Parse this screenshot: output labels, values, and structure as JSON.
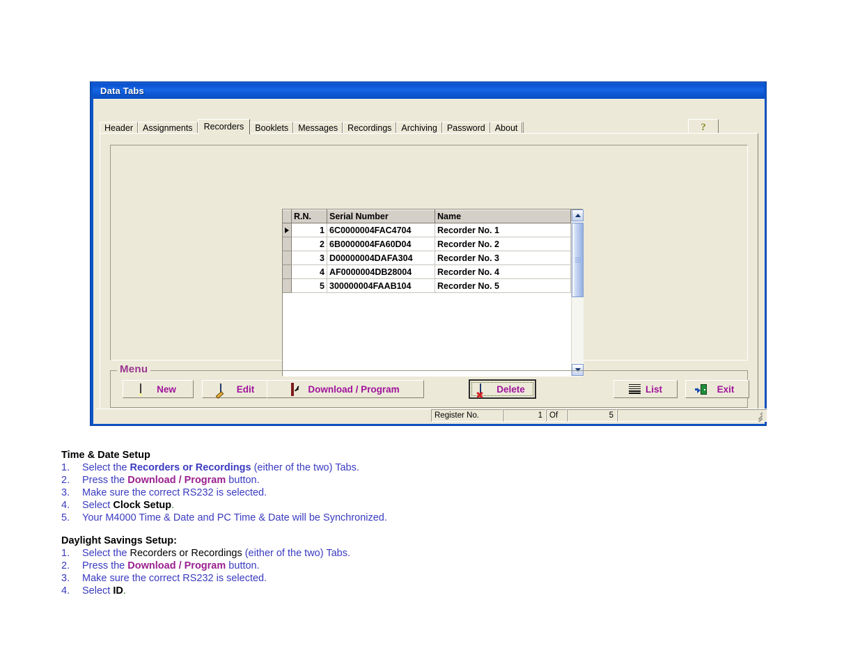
{
  "window": {
    "title": "Data Tabs",
    "help_button": "?",
    "help_icon": "question-mark-icon"
  },
  "tabs": [
    {
      "label": "Header",
      "selected": false
    },
    {
      "label": "Assignments",
      "selected": false
    },
    {
      "label": "Recorders",
      "selected": true
    },
    {
      "label": "Booklets",
      "selected": false
    },
    {
      "label": "Messages",
      "selected": false
    },
    {
      "label": "Recordings",
      "selected": false
    },
    {
      "label": "Archiving",
      "selected": false
    },
    {
      "label": "Password",
      "selected": false
    },
    {
      "label": "About",
      "selected": false
    }
  ],
  "grid": {
    "columns": [
      "R.N.",
      "Serial Number",
      "Name"
    ],
    "rows": [
      {
        "marker": true,
        "rn": "1",
        "serial": "6C0000004FAC4704",
        "name": "Recorder No. 1"
      },
      {
        "marker": false,
        "rn": "2",
        "serial": "6B0000004FA60D04",
        "name": "Recorder No. 2"
      },
      {
        "marker": false,
        "rn": "3",
        "serial": "D00000004DAFA304",
        "name": "Recorder No. 3"
      },
      {
        "marker": false,
        "rn": "4",
        "serial": "AF0000004DB28004",
        "name": "Recorder No. 4"
      },
      {
        "marker": false,
        "rn": "5",
        "serial": "300000004FAAB104",
        "name": "Recorder No. 5"
      }
    ]
  },
  "menu": {
    "legend": "Menu",
    "legend_color": "#9a3590",
    "button_text_color": "#a0139c",
    "buttons": [
      {
        "label": "New",
        "icon": "new-page-icon",
        "focused": false
      },
      {
        "label": "Edit",
        "icon": "edit-table-pencil-icon",
        "focused": false
      },
      {
        "label": "Download / Program",
        "icon": "clock-frame-icon",
        "focused": false
      },
      {
        "label": "Delete",
        "icon": "delete-table-x-icon",
        "focused": true
      },
      {
        "label": "List",
        "icon": "list-lines-icon",
        "focused": false
      },
      {
        "label": "Exit",
        "icon": "exit-door-arrow-icon",
        "focused": false
      }
    ]
  },
  "statusbar": {
    "register_label": "Register No.",
    "current": "1",
    "of": "Of",
    "total": "5"
  },
  "doc": {
    "section1": {
      "heading": "Time & Date Setup",
      "items": [
        {
          "n": "1.",
          "parts": [
            {
              "t": "Select the ",
              "s": "blu"
            },
            {
              "t": "Recorders or Recordings",
              "s": "blu b"
            },
            {
              "t": " (either of the two) Tabs.",
              "s": "blu"
            }
          ]
        },
        {
          "n": "2.",
          "parts": [
            {
              "t": "Press the ",
              "s": "blu"
            },
            {
              "t": "Download / Program",
              "s": "mag"
            },
            {
              "t": " button.",
              "s": "blu"
            }
          ]
        },
        {
          "n": "3.",
          "parts": [
            {
              "t": "Make sure the correct RS232 is selected.",
              "s": "blu"
            }
          ]
        },
        {
          "n": "4.",
          "parts": [
            {
              "t": "Select ",
              "s": "blu"
            },
            {
              "t": "Clock Setup",
              "s": "blk b"
            },
            {
              "t": ".",
              "s": "grn"
            }
          ]
        },
        {
          "n": "5.",
          "parts": [
            {
              "t": "Your M4000 Time & Date and PC Time & Date will be Synchronized.",
              "s": "blu"
            }
          ]
        }
      ]
    },
    "section2": {
      "heading": "Daylight Savings Setup:",
      "items": [
        {
          "n": "1.",
          "parts": [
            {
              "t": "Select the ",
              "s": "blu"
            },
            {
              "t": "Recorders or Recordings",
              "s": "blk"
            },
            {
              "t": " (either of the two) Tabs.",
              "s": "blu"
            }
          ]
        },
        {
          "n": "2.",
          "parts": [
            {
              "t": "Press the ",
              "s": "blu"
            },
            {
              "t": "Download / Program",
              "s": "mag"
            },
            {
              "t": " button.",
              "s": "blu"
            }
          ]
        },
        {
          "n": "3.",
          "parts": [
            {
              "t": "Make sure the correct RS232 is selected.",
              "s": "blu"
            }
          ]
        },
        {
          "n": "4.",
          "parts": [
            {
              "t": "Select ",
              "s": "blu"
            },
            {
              "t": "ID",
              "s": "blk b"
            },
            {
              "t": ".",
              "s": "grn"
            }
          ]
        }
      ]
    }
  }
}
